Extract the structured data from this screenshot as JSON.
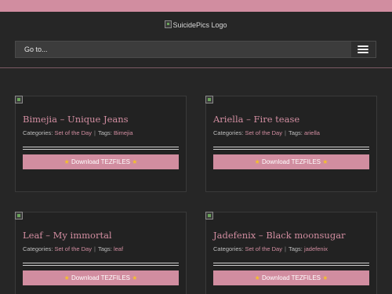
{
  "logo_alt": "SuicidePics Logo",
  "nav": {
    "label": "Go to..."
  },
  "posts": [
    {
      "title": "Bimejia – Unique Jeans",
      "categories_label": "Categories:",
      "category": "Set of the Day",
      "tags_label": "Tags:",
      "tag": "Bimejia",
      "download_label": "Download TEZFILES"
    },
    {
      "title": "Ariella – Fire tease",
      "categories_label": "Categories:",
      "category": "Set of the Day",
      "tags_label": "Tags:",
      "tag": "ariella",
      "download_label": "Download TEZFILES"
    },
    {
      "title": "Leaf – My immortal",
      "categories_label": "Categories:",
      "category": "Set of the Day",
      "tags_label": "Tags:",
      "tag": "leaf",
      "download_label": "Download TEZFILES"
    },
    {
      "title": "Jadefenix – Black moonsugar",
      "categories_label": "Categories:",
      "category": "Set of the Day",
      "tags_label": "Tags:",
      "tag": "jadefenix",
      "download_label": "Download TEZFILES"
    }
  ],
  "colors": {
    "accent": "#d18da0",
    "background": "#262626",
    "star": "#f5c02a"
  },
  "icons": {
    "download_star": "star-icon",
    "menu": "hamburger-icon"
  }
}
